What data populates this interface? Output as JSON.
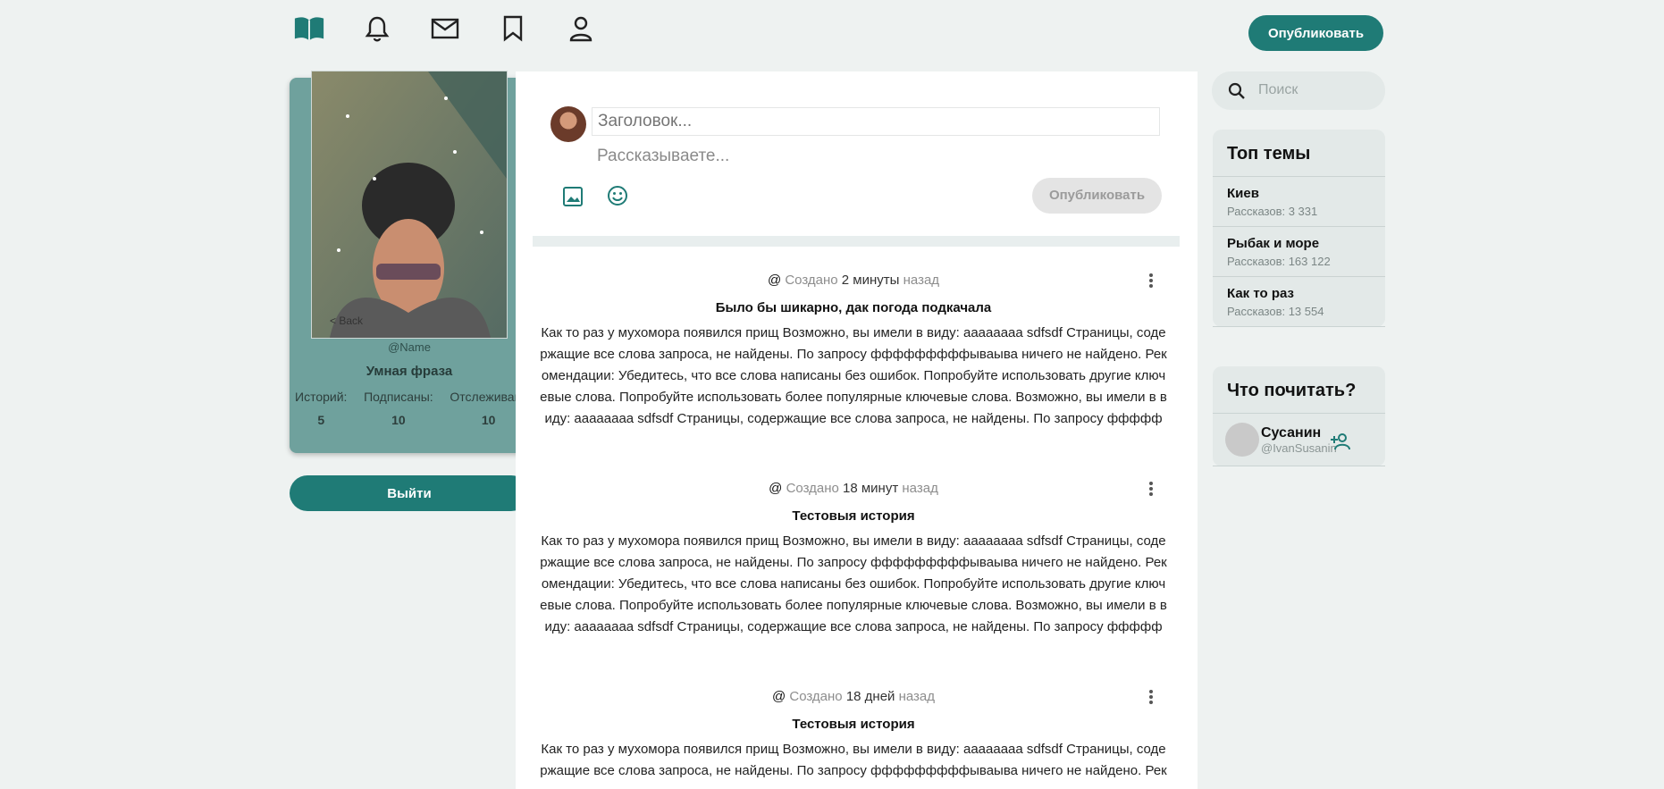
{
  "nav": {
    "icons": [
      "book-icon",
      "bell-icon",
      "mail-icon",
      "bookmark-icon",
      "user-icon"
    ],
    "publish_label": "Опубликовать"
  },
  "profile": {
    "back_label": "Back",
    "username": "@Name",
    "phrase": "Умная фраза",
    "stats": [
      {
        "label": "Историй:",
        "value": "5"
      },
      {
        "label": "Подписаны:",
        "value": "10"
      },
      {
        "label": "Отслеживаю:",
        "value": "10"
      }
    ],
    "logout_label": "Выйти"
  },
  "composer": {
    "title_placeholder": "Заголовок...",
    "story_placeholder": "Рассказываете...",
    "publish_label": "Опубликовать"
  },
  "posts": [
    {
      "at": "@",
      "created": "Создано",
      "time": "2 минуты",
      "ago": "назад",
      "title": "Было бы шикарно, дак погода подкачала",
      "body": "Как то раз у мухомора появился прищ Возможно, вы имели в виду: аааааааа sdfsdf Страницы, содержащие все слова запроса, не найдены. По запросу фффффффффываыва ничего не найдено. Рекомендации: Убедитесь, что все слова написаны без ошибок. Попробуйте использовать другие ключевые слова. Попробуйте использовать более популярные ключевые слова. Возможно, вы имели в виду: аааааааа sdfsdf Страницы, содержащие все слова запроса, не найдены. По запросу фффффффффываыва ничего не найдено. Рекомендации: Убедитесь, что все"
    },
    {
      "at": "@",
      "created": "Создано",
      "time": "18 минут",
      "ago": "назад",
      "title": "Тестовыя история",
      "body": "Как то раз у мухомора появился прищ Возможно, вы имели в виду: аааааааа sdfsdf Страницы, содержащие все слова запроса, не найдены. По запросу фффффффффываыва ничего не найдено. Рекомендации: Убедитесь, что все слова написаны без ошибок. Попробуйте использовать другие ключевые слова. Попробуйте использовать более популярные ключевые слова. Возможно, вы имели в виду: аааааааа sdfsdf Страницы, содержащие все слова запроса, не найдены. По запросу фффффффффываыва ничего не найдено. Рекомендации: Убедитесь, что все"
    },
    {
      "at": "@",
      "created": "Создано",
      "time": "18 дней",
      "ago": "назад",
      "title": "Тестовыя история",
      "body": "Как то раз у мухомора появился прищ Возможно, вы имели в виду: аааааааа sdfsdf Страницы, содержащие все слова запроса, не найдены. По запросу фффффффффываыва ничего не найдено. Рекомендации: Убедитесь, что все слова написаны без ошибок."
    }
  ],
  "search": {
    "placeholder": "Поиск"
  },
  "top_topics": {
    "title": "Топ темы",
    "items": [
      {
        "name": "Киев",
        "count": "Рассказов: 3 331"
      },
      {
        "name": "Рыбак и море",
        "count": "Рассказов: 163 122"
      },
      {
        "name": "Как то раз",
        "count": "Рассказов: 13 554"
      }
    ]
  },
  "suggestions": {
    "title": "Что почитать?",
    "users": [
      {
        "name": "Сусанин",
        "handle": "@IvanSusanin"
      }
    ]
  },
  "colors": {
    "accent": "#1f7b76",
    "profile_bg": "#6fa19d",
    "page_bg": "#eef2f1"
  }
}
